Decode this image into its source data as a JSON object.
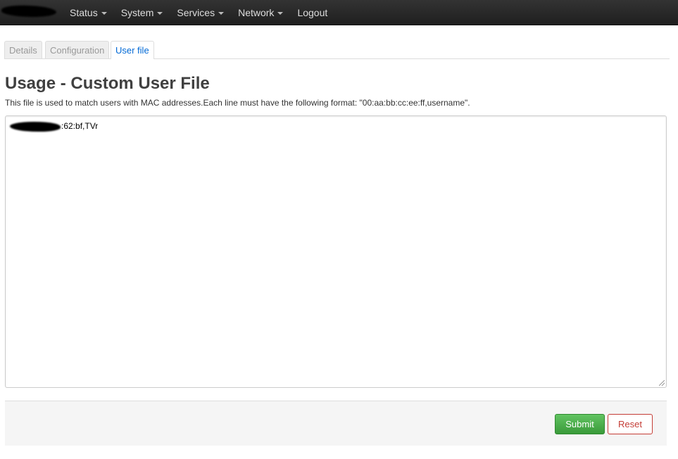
{
  "nav": {
    "items": [
      {
        "label": "Status",
        "dropdown": true
      },
      {
        "label": "System",
        "dropdown": true
      },
      {
        "label": "Services",
        "dropdown": true
      },
      {
        "label": "Network",
        "dropdown": true
      },
      {
        "label": "Logout",
        "dropdown": false
      }
    ]
  },
  "tabs": [
    {
      "label": "Details",
      "active": false
    },
    {
      "label": "Configuration",
      "active": false
    },
    {
      "label": "User file",
      "active": true
    }
  ],
  "page": {
    "title": "Usage - Custom User File",
    "description": "This file is used to match users with MAC addresses.Each line must have the following format: \"00:aa:bb:cc:ee:ff,username\"."
  },
  "editor": {
    "visible_text": ":62:bf,TVr"
  },
  "actions": {
    "submit_label": "Submit",
    "reset_label": "Reset"
  },
  "colors": {
    "topbar": "#222222",
    "active_tab": "#0069d6",
    "submit": "#46a546",
    "reset": "#c43c35"
  }
}
